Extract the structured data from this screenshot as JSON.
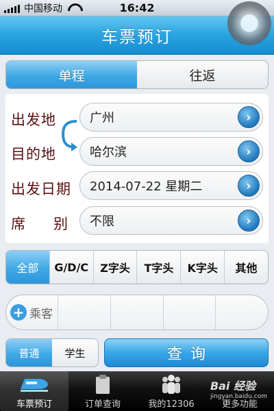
{
  "status_bar": {
    "carrier": "中国移动",
    "time": "16:42"
  },
  "header": {
    "title": "车票预订"
  },
  "trip_type": {
    "options": [
      "单程",
      "往返"
    ],
    "selected": "单程"
  },
  "form": {
    "from_label": "出发地",
    "from_value": "广州",
    "to_label": "目的地",
    "to_value": "哈尔滨",
    "date_label": "出发日期",
    "date_value": "2014-07-22 星期二",
    "seat_label_1": "席",
    "seat_label_2": "别",
    "seat_value": "不限"
  },
  "train_filter": {
    "options": [
      "全部",
      "G/D/C",
      "Z字头",
      "T字头",
      "K字头",
      "其他"
    ],
    "selected": "全部"
  },
  "passengers": {
    "add_label": "乘客"
  },
  "ticket_type": {
    "options": [
      "普通",
      "学生"
    ],
    "selected": "普通"
  },
  "query_button": {
    "label": "查询"
  },
  "tab_bar": {
    "items": [
      "车票预订",
      "订单查询",
      "我的12306",
      "更多功能"
    ],
    "selected": "车票预订"
  },
  "watermark": {
    "brand": "Bai 经验",
    "url": "jingyan.baidu.com"
  },
  "colors": {
    "accent": "#2aa3e0",
    "label_text": "#5a0f12",
    "arrow_button": "#1f77bd"
  },
  "icons": {
    "swap": "swap-arrows-icon",
    "field_arrow": "chevron-right-icon",
    "add_passenger": "plus-circle-icon",
    "tabs": [
      "train-icon",
      "clipboard-icon",
      "people-icon",
      "more-icon"
    ]
  }
}
